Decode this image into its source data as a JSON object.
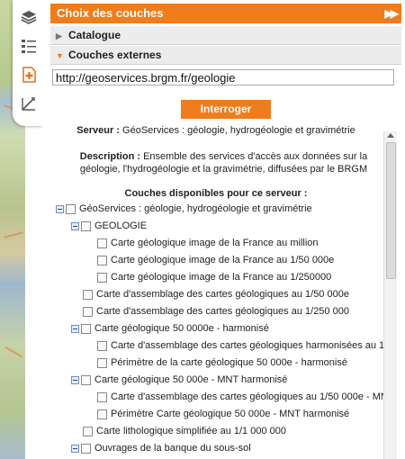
{
  "panel": {
    "title": "Choix des couches",
    "sections": {
      "catalogue": "Catalogue",
      "external": "Couches externes"
    },
    "url_value": "http://geoservices.brgm.fr/geologie",
    "query_button": "Interroger",
    "server_label": "Serveur :",
    "server_name": "GéoServices : géologie, hydrogéologie et gravimétrie",
    "description_label": "Description :",
    "description_text": "Ensemble des services d'accès aux données sur la géologie, l'hydrogéologie et la gravimétrie, diffusées par le BRGM",
    "available_layers_label": "Couches disponibles pour ce serveur :"
  },
  "tree": [
    {
      "label": "GéoServices : géologie, hydrogéologie et gravimétrie",
      "level": 0,
      "expander": true
    },
    {
      "label": "GEOLOGIE",
      "level": 1,
      "expander": true
    },
    {
      "label": "Carte géologique image de la France au million",
      "level": 2,
      "expander": false
    },
    {
      "label": "Carte géologique image de la France au 1/50 000e",
      "level": 2,
      "expander": false
    },
    {
      "label": "Carte géologique image de la France au 1/250000",
      "level": 2,
      "expander": false
    },
    {
      "label": "Carte d'assemblage des cartes géologiques au 1/50 000e",
      "level": 1,
      "expander": false
    },
    {
      "label": "Carte d'assemblage des cartes géologiques au 1/250 000",
      "level": 1,
      "expander": false
    },
    {
      "label": "Carte géologique 50 0000e - harmonisé",
      "level": 1,
      "expander": true
    },
    {
      "label": "Carte d'assemblage des cartes géologiques harmonisées au 1/",
      "level": 2,
      "expander": false
    },
    {
      "label": "Périmètre de la carte géologique 50 000e - harmonisé",
      "level": 2,
      "expander": false
    },
    {
      "label": "Carte géologique 50 000e - MNT harmonisé",
      "level": 1,
      "expander": true
    },
    {
      "label": "Carte d'assemblage des cartes géologiques au 1/50 000e - MN",
      "level": 2,
      "expander": false
    },
    {
      "label": "Périmètre Carte géologique 50 000e - MNT harmonisé",
      "level": 2,
      "expander": false
    },
    {
      "label": "Carte lithologique simplifiée au 1/1 000 000",
      "level": 1,
      "expander": false
    },
    {
      "label": "Ouvrages de la banque du sous-sol",
      "level": 1,
      "expander": true
    }
  ],
  "toolbar": {
    "icons": [
      "layers-icon",
      "layer-list-icon",
      "add-layer-icon",
      "measure-icon"
    ]
  },
  "colors": {
    "accent": "#f07c1c",
    "section_bg": "#ececec"
  }
}
